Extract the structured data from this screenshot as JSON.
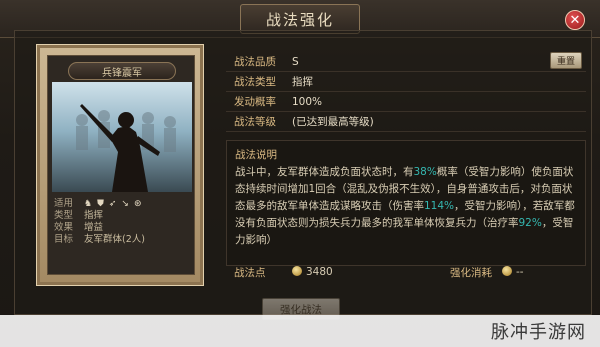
{
  "header": {
    "title": "战法强化",
    "close_icon": "close-icon"
  },
  "card": {
    "name": "兵锋震军",
    "info": [
      {
        "key": "适用",
        "value": ""
      },
      {
        "key": "类型",
        "value": "指挥"
      },
      {
        "key": "效果",
        "value": "增益"
      },
      {
        "key": "目标",
        "value": "友军群体(2人)"
      }
    ],
    "applicable_icons": [
      "cavalry-icon",
      "shield-icon",
      "bow-icon",
      "spear-icon",
      "siege-icon"
    ]
  },
  "details": {
    "rows": [
      {
        "key": "战法品质",
        "value": "S"
      },
      {
        "key": "战法类型",
        "value": "指挥"
      },
      {
        "key": "发动概率",
        "value": "100%"
      },
      {
        "key": "战法等级",
        "value": "(已达到最高等级)"
      }
    ],
    "reset_button": "重置"
  },
  "description": {
    "title": "战法说明",
    "text_parts": [
      {
        "t": "战斗中，友军群体造成负面状态时，有"
      },
      {
        "t": "38%",
        "hl": true
      },
      {
        "t": "概率（受智力影响）使负面状态持续时间增加1回合（混乱及伪报不生效），自身普通攻击后，对负面状态最多的敌军单体造成谋略攻击（伤害率"
      },
      {
        "t": "114%",
        "hl": true
      },
      {
        "t": "，受智力影响），若敌军都没有负面状态则为损失兵力最多的我军单体恢复兵力（治疗率"
      },
      {
        "t": "92%",
        "hl": true
      },
      {
        "t": "，受智力影响）"
      }
    ]
  },
  "footer": {
    "cost_label": "战法点",
    "cost_value": "3480",
    "enhance_label": "强化消耗",
    "enhance_value": "--"
  },
  "confirm_button": "强化战法",
  "watermark": "脉冲手游网"
}
